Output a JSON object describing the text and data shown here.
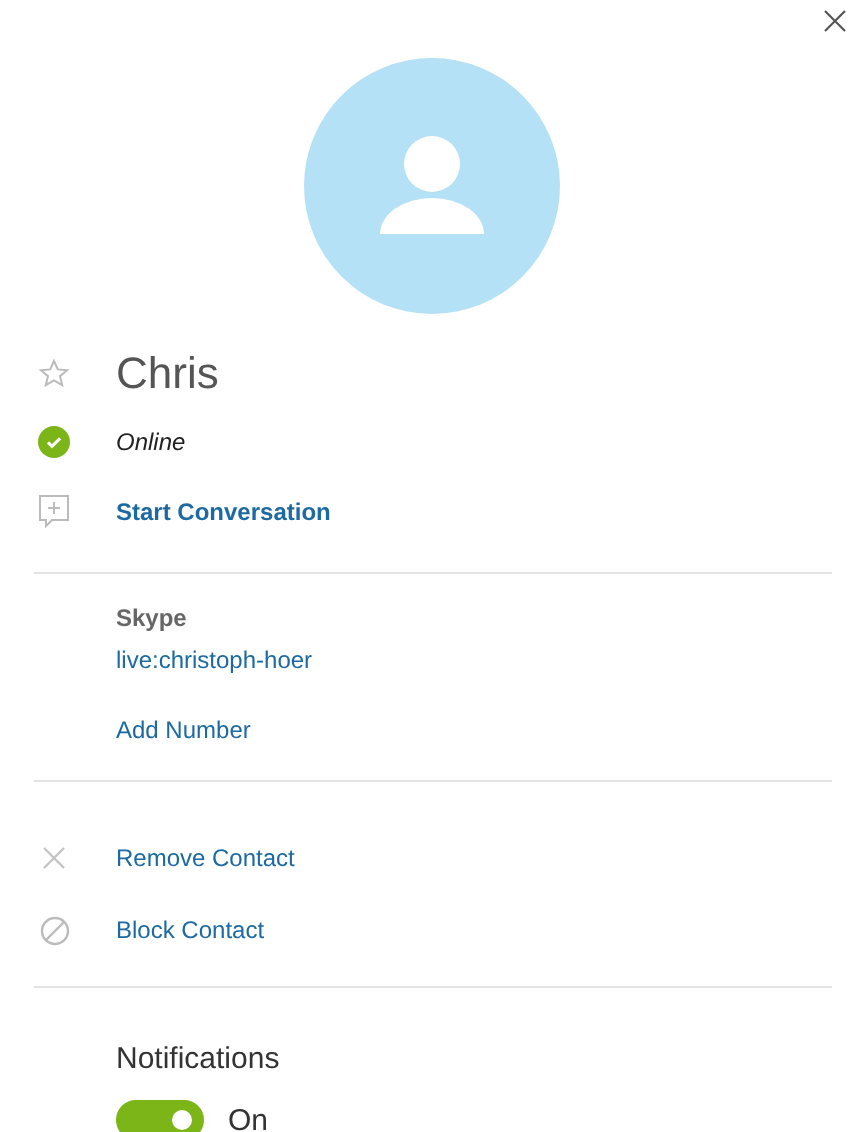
{
  "contact": {
    "name": "Chris",
    "favorite": false,
    "status": {
      "kind": "online",
      "label": "Online"
    }
  },
  "primary_action": {
    "kind": "chat",
    "label": "Start Conversation"
  },
  "accounts": {
    "label": "Skype",
    "id": "live:christoph-hoer",
    "add_link": "Add Number"
  },
  "actions": [
    {
      "kind": "remove",
      "label": "Remove Contact"
    },
    {
      "kind": "block",
      "label": "Block Contact"
    }
  ],
  "notifications": {
    "label": "Notifications",
    "on": true,
    "state_label": "On"
  }
}
